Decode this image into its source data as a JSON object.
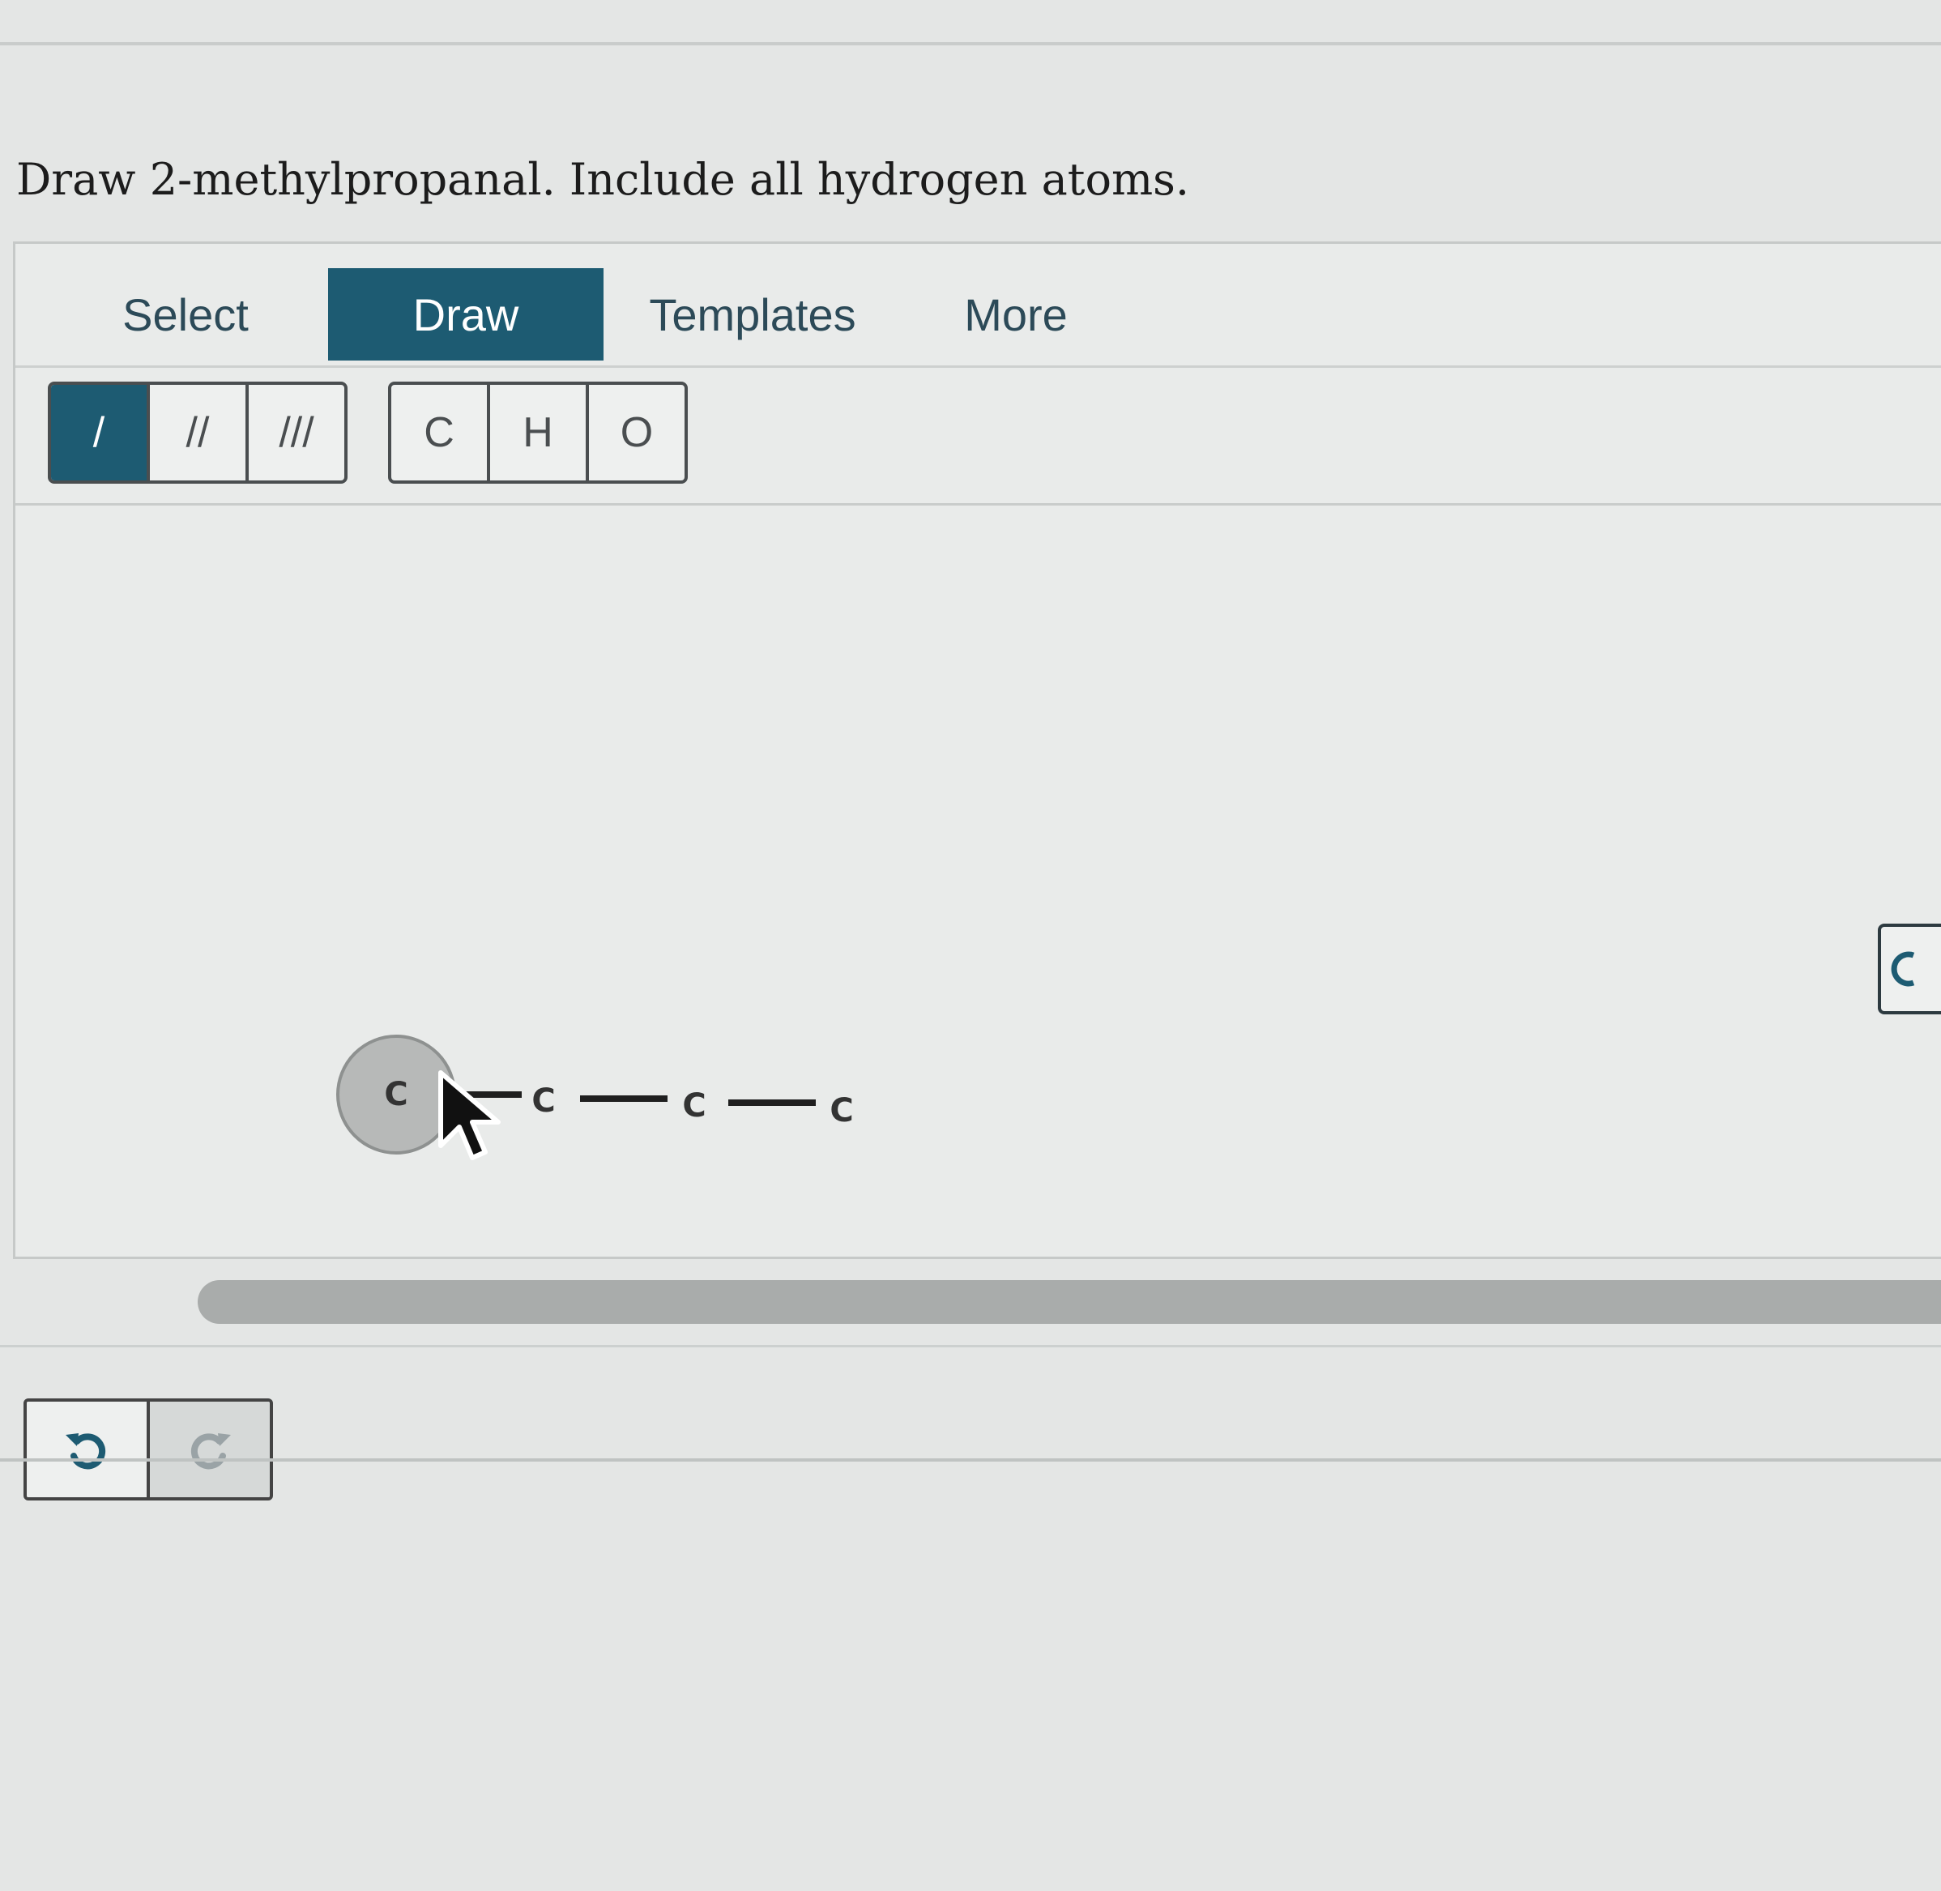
{
  "question": {
    "text": "Draw 2-methylpropanal. Include all hydrogen atoms."
  },
  "tabs": [
    {
      "label": "Select",
      "active": false
    },
    {
      "label": "Draw",
      "active": true
    },
    {
      "label": "Templates",
      "active": false
    },
    {
      "label": "More",
      "active": false
    }
  ],
  "bond_tools": [
    {
      "icon": "single-bond-icon",
      "glyph": "/",
      "active": true
    },
    {
      "icon": "double-bond-icon",
      "glyph": "//",
      "active": false
    },
    {
      "icon": "triple-bond-icon",
      "glyph": "///",
      "active": false
    }
  ],
  "atom_tools": [
    {
      "label": "C"
    },
    {
      "label": "H"
    },
    {
      "label": "O"
    }
  ],
  "molecule": {
    "atoms": [
      {
        "label": "C",
        "highlighted": true
      },
      {
        "label": "C",
        "highlighted": false
      },
      {
        "label": "C",
        "highlighted": false
      },
      {
        "label": "C",
        "highlighted": false
      }
    ],
    "bonds": [
      "single",
      "single",
      "single"
    ]
  },
  "history": {
    "undo_icon": "undo-icon",
    "redo_icon": "redo-icon",
    "redo_enabled": false
  },
  "colors": {
    "accent": "#1d5b72",
    "background": "#e4e6e5",
    "border": "#4a4e50"
  }
}
